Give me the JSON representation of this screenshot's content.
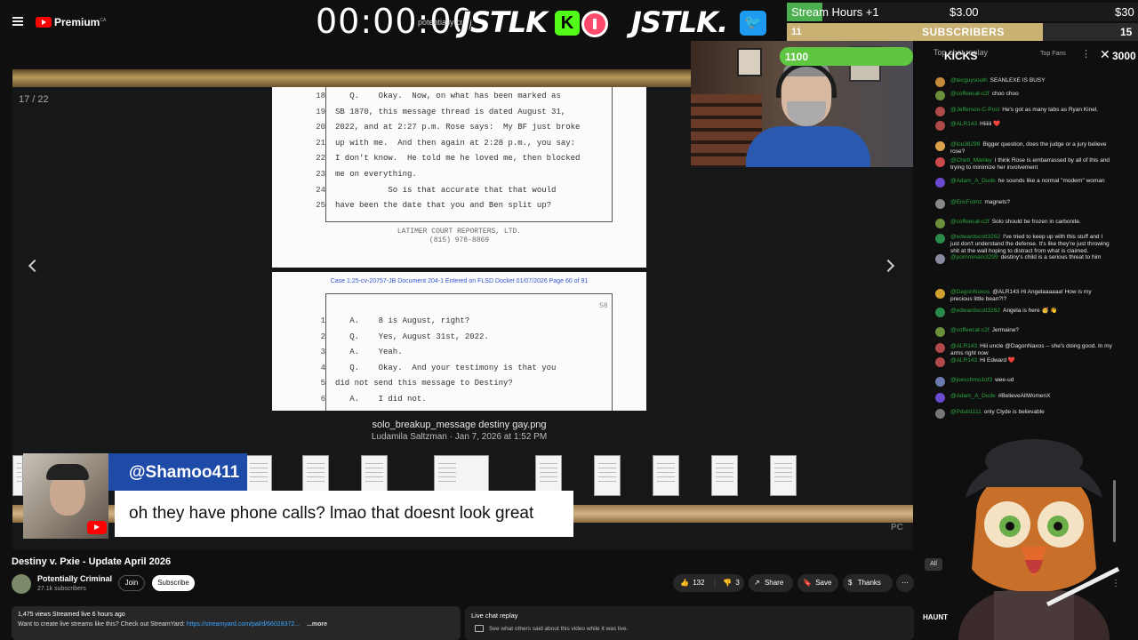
{
  "topbar": {
    "premium_label": "Premium",
    "premium_region": "CA"
  },
  "overlay": {
    "timer": "00:00:00",
    "timer_sub": "potentially crim",
    "brand1": "JSTLK",
    "kick_letter": "K",
    "brand2": "JSTLK.",
    "stream_hours": {
      "label": "Stream Hours +1",
      "price": "$3.00",
      "max": "$30",
      "progress": 0.1
    },
    "subscribers": {
      "count": "11",
      "label": "SUBSCRIBERS",
      "goal": "15",
      "progress": 0.73
    },
    "kicks": {
      "count": "1100",
      "label": "KICKS",
      "goal": "3000",
      "progress": 1.0
    }
  },
  "player": {
    "counter": "17 / 22",
    "file_name": "solo_breakup_message destiny gay.png",
    "file_meta": "Ludamila Saltzman · Jan 7, 2026 at 1:52 PM",
    "doc1": {
      "lines": [
        {
          "n": "18",
          "t": "   Q.    Okay.  Now, on what has been marked as"
        },
        {
          "n": "19",
          "t": "SB 1870, this message thread is dated August 31,"
        },
        {
          "n": "20",
          "t": "2022, and at 2:27 p.m. Rose says:  My BF just broke"
        },
        {
          "n": "21",
          "t": "up with me.  And then again at 2:28 p.m., you say:"
        },
        {
          "n": "22",
          "t": "I don't know.  He told me he loved me, then blocked"
        },
        {
          "n": "23",
          "t": "me on everything."
        },
        {
          "n": "24",
          "t": "           So is that accurate that that would"
        },
        {
          "n": "25",
          "t": "have been the date that you and Ben split up?"
        }
      ],
      "reporter": "LATIMER COURT REPORTERS, LTD.",
      "phone": "(815) 978-8869"
    },
    "doc2": {
      "case_header": "Case 1:25-cv-20757-JB   Document 204-1   Entered on FLSD Docket 01/07/2026   Page 60 of 91",
      "page_no": "58",
      "lines": [
        {
          "n": "1",
          "t": "   A.    8 is August, right?"
        },
        {
          "n": "2",
          "t": "   Q.    Yes, August 31st, 2022."
        },
        {
          "n": "3",
          "t": "   A.    Yeah."
        },
        {
          "n": "4",
          "t": "   Q.    Okay.  And your testimony is that you"
        },
        {
          "n": "5",
          "t": "did not send this message to Destiny?"
        },
        {
          "n": "6",
          "t": "   A.    I did not."
        }
      ]
    }
  },
  "caption": {
    "username": "@Shamoo411",
    "message": "oh they have phone calls? lmao that doesnt look great"
  },
  "chat": {
    "header": "Top chat replay",
    "top_fans": "Top Fans",
    "messages": [
      {
        "author": "@tecguysouth",
        "text": "SEANLEXE IS BUSY",
        "color": "#c58b3a"
      },
      {
        "author": "@coffeecat-c2f",
        "text": "choo choo",
        "color": "#6b8f3a"
      },
      {
        "author": "@Jefferson-C-Post",
        "text": "He's got as many tabs as Ryan Kinel.",
        "color": "#b04a4a"
      },
      {
        "author": "@ALR143",
        "text": "Hiiiiii ❤️",
        "color": "#b04a4a"
      },
      {
        "author": "@lou38299",
        "text": "Bigger question, does the judge or a jury believe rose?",
        "color": "#d9a14a"
      },
      {
        "author": "@Chett_Manley",
        "text": "I think Rose is embarrassed by all of this and trying to minimize her involvement",
        "color": "#cc4a4a"
      },
      {
        "author": "@Adam_A_Dude",
        "text": "he sounds like a normal \"modern\" woman",
        "color": "#6a4ad0"
      },
      {
        "author": "@EricFolmz",
        "text": "magnets?",
        "color": "#888"
      },
      {
        "author": "@coffeecat-c2f",
        "text": "Solo should be frozen in carbonite.",
        "color": "#6b8f3a"
      },
      {
        "author": "@edwardscott3262",
        "text": "I've tried to keep up with this stuff and I just don't understand the defense. It's like they're just throwing shit at the wall hoping to distract from what is claimed.",
        "color": "#2a8a4a"
      },
      {
        "author": "@pornminarx3299",
        "text": "destiny's child is a serious threat to him",
        "color": "#8a8aa0"
      },
      {
        "author": "@DagonNaxos",
        "text": "@ALR143 Hi Angelaaaaaa! How is my precious little bean?!?",
        "color": "#d0a030"
      },
      {
        "author": "@edwardscott3262",
        "text": "Angela is here 🥳 👋",
        "color": "#2a8a4a"
      },
      {
        "author": "@coffeecat-c2f",
        "text": "Jermaine?",
        "color": "#6b8f3a"
      },
      {
        "author": "@ALR143",
        "text": "Hiii uncle @DagonNaxos -- she's doing good. In my arms right now",
        "color": "#b04a4a"
      },
      {
        "author": "@ALR143",
        "text": "Hi Edward ❤️",
        "color": "#b04a4a"
      },
      {
        "author": "@joeschmo1of3",
        "text": "wee-ud",
        "color": "#6a7ab0"
      },
      {
        "author": "@Adam_A_Dude",
        "text": "#BelieveAllWomenX",
        "color": "#6a4ad0"
      },
      {
        "author": "@Pdub1111",
        "text": "only Clyde is believable",
        "color": "#777"
      }
    ]
  },
  "below": {
    "title": "Destiny v. Pxie - Update April 2026",
    "channel": "Potentially Criminal",
    "subs": "27.1k subscribers",
    "join": "Join",
    "subscribe": "Subscribe",
    "likes": "132",
    "dislikes": "3",
    "share": "Share",
    "save": "Save",
    "thanks": "Thanks",
    "stats": "1,475 views  Streamed live 6 hours ago",
    "desc": "Want to create live streams like this? Check out StreamYard: ",
    "desc_link": "https://streamyard.com/pal/d/66028372...",
    "desc_more": "...more",
    "replay_title": "Live chat replay",
    "replay_sub": "See what others said about this video while it was live.",
    "chat_all": "All",
    "haunt": "HAUNT"
  },
  "colors": {
    "brand_red": "#ff0000",
    "kick_green": "#53fc18",
    "twitter_blue": "#1d9bf0",
    "caption_blue": "#1f4ba8"
  },
  "icons": [
    "menu-icon",
    "youtube-logo-icon",
    "kick-icon",
    "record-icon",
    "twitter-icon",
    "chevron-left-icon",
    "chevron-right-icon",
    "close-icon",
    "more-icon",
    "like-icon",
    "dislike-icon",
    "share-icon",
    "save-icon",
    "thanks-icon"
  ]
}
